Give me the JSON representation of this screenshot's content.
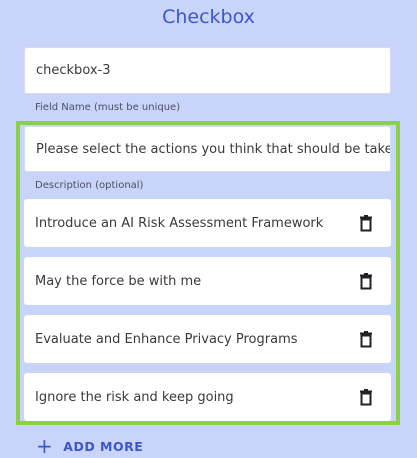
{
  "title": "Checkbox",
  "field_name": {
    "value": "checkbox-3",
    "helper": "Field Name (must be unique)"
  },
  "description": {
    "value": "Please select the actions you think that should be taken",
    "helper": "Description (optional)"
  },
  "options": [
    {
      "label": "Introduce an AI Risk Assessment Framework",
      "icon": "trash-icon"
    },
    {
      "label": "May the force be with me",
      "icon": "trash-icon"
    },
    {
      "label": "Evaluate and Enhance Privacy Programs",
      "icon": "trash-icon"
    },
    {
      "label": "Ignore the risk and keep going",
      "icon": "trash-icon"
    }
  ],
  "add_more": {
    "icon": "plus-icon",
    "label": "ADD MORE"
  },
  "colors": {
    "background": "#c9d4fb",
    "accent": "#3d57c6",
    "highlight_border": "#8ad04a"
  }
}
